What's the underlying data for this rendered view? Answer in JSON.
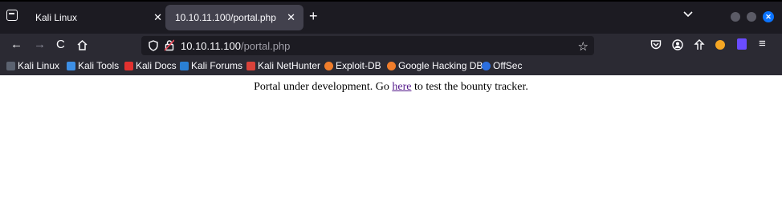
{
  "tabs": [
    {
      "label": "Kali Linux"
    },
    {
      "label": "10.10.11.100/portal.php"
    }
  ],
  "url": {
    "host": "10.10.11.100",
    "path": "/portal.php"
  },
  "bookmarks": [
    {
      "label": "Kali Linux"
    },
    {
      "label": "Kali Tools"
    },
    {
      "label": "Kali Docs"
    },
    {
      "label": "Kali Forums"
    },
    {
      "label": "Kali NetHunter"
    },
    {
      "label": "Exploit-DB"
    },
    {
      "label": "Google Hacking DB"
    },
    {
      "label": "OffSec"
    }
  ],
  "content": {
    "prefix": "Portal under development. Go ",
    "link": "here",
    "suffix": " to test the bounty tracker."
  },
  "colors": {
    "accent": "#0b74ff",
    "chrome_dark": "#1c1b22",
    "toolbar": "#2b2a33",
    "visited_link": "#551a8b"
  }
}
